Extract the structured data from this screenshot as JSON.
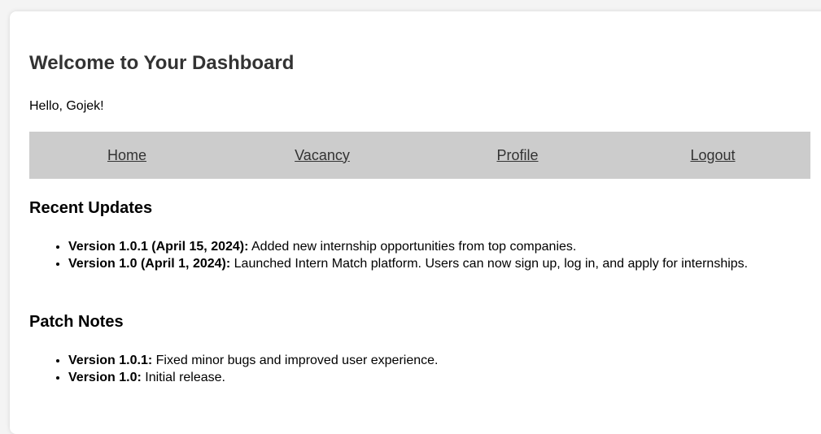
{
  "dashboard": {
    "title": "Welcome to Your Dashboard",
    "greeting": "Hello, Gojek!"
  },
  "nav": {
    "items": [
      {
        "label": "Home"
      },
      {
        "label": "Vacancy"
      },
      {
        "label": "Profile"
      },
      {
        "label": "Logout"
      }
    ]
  },
  "recent_updates": {
    "title": "Recent Updates",
    "items": [
      {
        "label": "Version 1.0.1 (April 15, 2024):",
        "text": " Added new internship opportunities from top companies."
      },
      {
        "label": "Version 1.0 (April 1, 2024):",
        "text": " Launched Intern Match platform. Users can now sign up, log in, and apply for internships."
      }
    ]
  },
  "patch_notes": {
    "title": "Patch Notes",
    "items": [
      {
        "label": "Version 1.0.1:",
        "text": " Fixed minor bugs and improved user experience."
      },
      {
        "label": "Version 1.0:",
        "text": " Initial release."
      }
    ]
  }
}
